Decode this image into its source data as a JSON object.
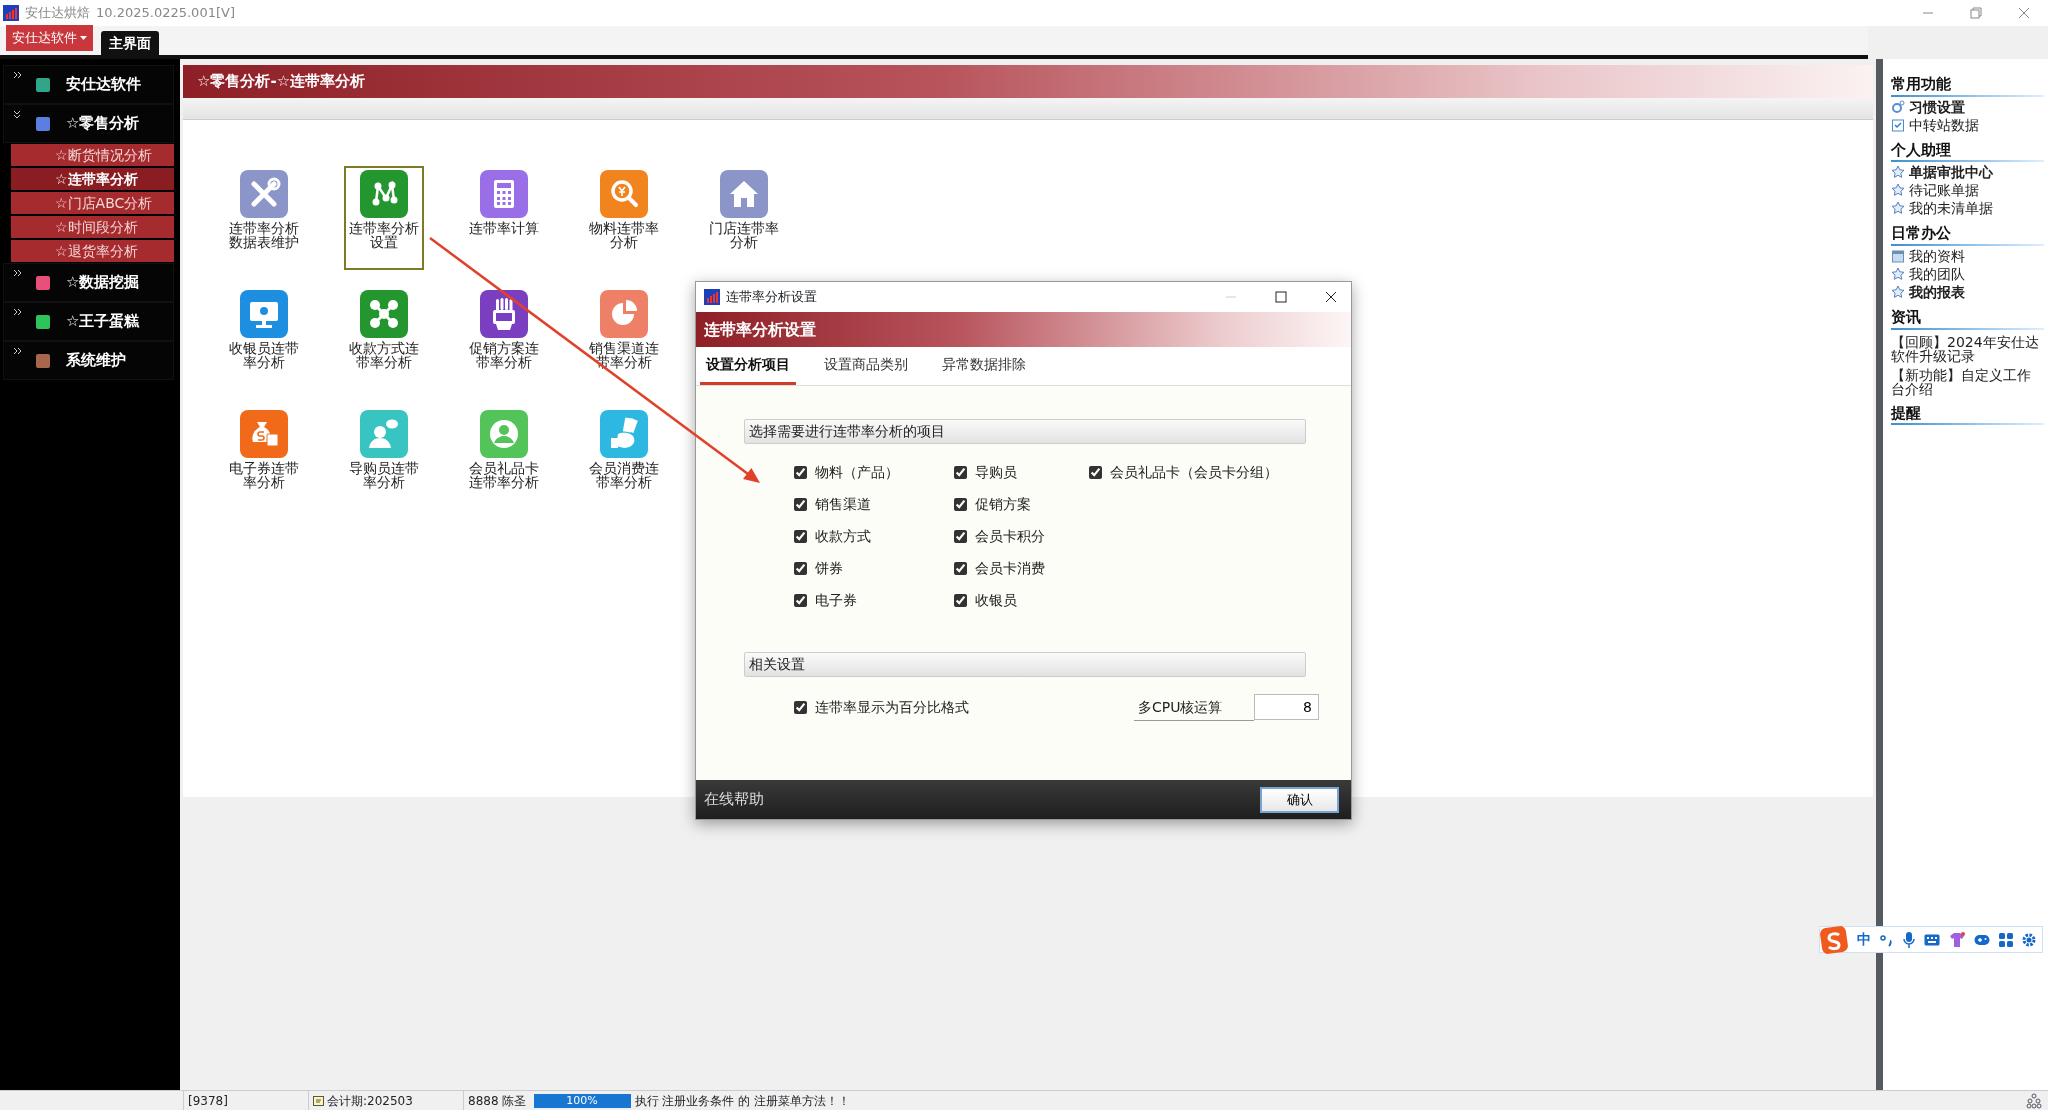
{
  "app": {
    "title": "安仕达烘焙",
    "version": "10.2025.0225.001[V]"
  },
  "menu_button": {
    "label": "安仕达软件"
  },
  "tabs": [
    {
      "label": "主界面",
      "selected": true
    }
  ],
  "sidebar": {
    "groups": [
      {
        "label": "安仕达软件",
        "color": "#2fa58a",
        "expanded": false
      },
      {
        "label": "☆零售分析",
        "color": "#5b7fe0",
        "expanded": true,
        "children": [
          {
            "label": "☆断货情况分析",
            "selected": false
          },
          {
            "label": "☆连带率分析",
            "selected": true
          },
          {
            "label": "☆门店ABC分析",
            "selected": false
          },
          {
            "label": "☆时间段分析",
            "selected": false
          },
          {
            "label": "☆退货率分析",
            "selected": false
          }
        ]
      },
      {
        "label": "☆数据挖掘",
        "color": "#e8507a",
        "expanded": false
      },
      {
        "label": "☆王子蛋糕",
        "color": "#2fc45a",
        "expanded": false
      },
      {
        "label": "系统维护",
        "color": "#a8674a",
        "expanded": false
      }
    ]
  },
  "main": {
    "title": "☆零售分析-☆连带率分析",
    "tile_rows": [
      [
        {
          "label": "连带率分析数据表维护",
          "color": "#8c95c8",
          "selected": false
        },
        {
          "label": "连带率分析设置",
          "color": "#23962f",
          "selected": true
        },
        {
          "label": "连带率计算",
          "color": "#9a6ee6",
          "selected": false
        },
        {
          "label": "物料连带率分析",
          "color": "#f2841f",
          "selected": false
        },
        {
          "label": "门店连带率分析",
          "color": "#8c95c8",
          "selected": false
        }
      ],
      [
        {
          "label": "收银员连带率分析",
          "color": "#1e8fe0",
          "selected": false
        },
        {
          "label": "收款方式连带率分析",
          "color": "#23962f",
          "selected": false
        },
        {
          "label": "促销方案连带率分析",
          "color": "#7a3fc0",
          "selected": false
        },
        {
          "label": "销售渠道连带率分析",
          "color": "#ee8068",
          "selected": false
        }
      ],
      [
        {
          "label": "电子券连带率分析",
          "color": "#f06a1a",
          "selected": false
        },
        {
          "label": "导购员连带率分析",
          "color": "#38c4c0",
          "selected": false
        },
        {
          "label": "会员礼品卡连带率分析",
          "color": "#52c45a",
          "selected": false
        },
        {
          "label": "会员消费连带率分析",
          "color": "#2cb8e0",
          "selected": false
        }
      ]
    ]
  },
  "dialog": {
    "title": "连带率分析设置",
    "header": "连带率分析设置",
    "tabs": [
      {
        "label": "设置分析项目",
        "selected": true
      },
      {
        "label": "设置商品类别",
        "selected": false
      },
      {
        "label": "异常数据排除",
        "selected": false
      }
    ],
    "items_section": {
      "title": "选择需要进行连带率分析的项目",
      "columns": [
        [
          {
            "label": "物料（产品）",
            "checked": true
          },
          {
            "label": "销售渠道",
            "checked": true
          },
          {
            "label": "收款方式",
            "checked": true
          },
          {
            "label": "饼券",
            "checked": true
          },
          {
            "label": "电子券",
            "checked": true
          }
        ],
        [
          {
            "label": "导购员",
            "checked": true
          },
          {
            "label": "促销方案",
            "checked": true
          },
          {
            "label": "会员卡积分",
            "checked": true
          },
          {
            "label": "会员卡消费",
            "checked": true
          },
          {
            "label": "收银员",
            "checked": true
          }
        ],
        [
          {
            "label": "会员礼品卡（会员卡分组）",
            "checked": true
          }
        ]
      ]
    },
    "settings_section": {
      "title": "相关设置",
      "percent_option": {
        "label": "连带率显示为百分比格式",
        "checked": true
      },
      "cpu_field": {
        "label": "多CPU核运算",
        "value": "8"
      }
    },
    "help_link": "在线帮助",
    "confirm_button": "确认"
  },
  "right_panel": {
    "sections": [
      {
        "title": "常用功能",
        "items": [
          {
            "label": "习惯设置",
            "kind": "gear",
            "emphasized": true
          },
          {
            "label": "中转站数据",
            "kind": "clipboard",
            "emphasized": false
          }
        ]
      },
      {
        "title": "个人助理",
        "items": [
          {
            "label": "单据审批中心",
            "kind": "star",
            "emphasized": true
          },
          {
            "label": "待记账单据",
            "kind": "star",
            "emphasized": false
          },
          {
            "label": "我的未清单据",
            "kind": "star",
            "emphasized": false
          }
        ]
      },
      {
        "title": "日常办公",
        "items": [
          {
            "label": "我的资料",
            "kind": "calendar",
            "emphasized": false
          },
          {
            "label": "我的团队",
            "kind": "star",
            "emphasized": false
          },
          {
            "label": "我的报表",
            "kind": "star",
            "emphasized": true
          }
        ]
      },
      {
        "title": "资讯",
        "items": [
          {
            "label": "【回顾】2024年安仕达软件升级记录",
            "kind": "news",
            "emphasized": false
          },
          {
            "label": "【新功能】自定义工作台介绍",
            "kind": "news",
            "emphasized": false
          }
        ]
      },
      {
        "title": "提醒"
      }
    ]
  },
  "ime_toolbar": {
    "mode": "中"
  },
  "status_bar": {
    "code": "[9378]",
    "period": "会计期:202503",
    "user_code": "8888",
    "user_name": "陈圣",
    "progress": {
      "level": 1,
      "reading": "100%"
    },
    "message": "执行 注册业务条件 的 注册菜单方法！！"
  }
}
